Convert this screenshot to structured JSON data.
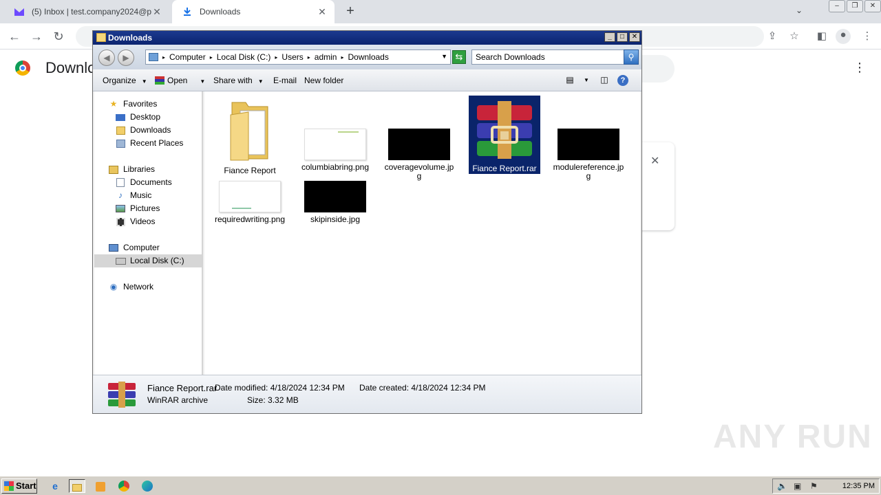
{
  "browser": {
    "tabs": [
      {
        "title": "(5) Inbox | test.company2024@prot",
        "icon": "proton-mail-icon",
        "active": false
      },
      {
        "title": "Downloads",
        "icon": "download-icon",
        "active": true
      }
    ],
    "page_title": "Downlo"
  },
  "explorer": {
    "title": "Downloads",
    "breadcrumb": [
      "Computer",
      "Local Disk (C:)",
      "Users",
      "admin",
      "Downloads"
    ],
    "search_placeholder": "Search Downloads",
    "commands": {
      "organize": "Organize",
      "open": "Open",
      "share_with": "Share with",
      "email": "E-mail",
      "new_folder": "New folder"
    },
    "nav": {
      "favorites": "Favorites",
      "desktop": "Desktop",
      "downloads": "Downloads",
      "recent_places": "Recent Places",
      "libraries": "Libraries",
      "documents": "Documents",
      "music": "Music",
      "pictures": "Pictures",
      "videos": "Videos",
      "computer": "Computer",
      "local_disk": "Local Disk (C:)",
      "network": "Network"
    },
    "files": [
      {
        "name": "Fiance Report",
        "type": "folder"
      },
      {
        "name": "columbiabring.png",
        "type": "image-light"
      },
      {
        "name": "coveragevolume.jpg",
        "type": "image-dark"
      },
      {
        "name": "Fiance Report.rar",
        "type": "rar",
        "selected": true
      },
      {
        "name": "modulereference.jpg",
        "type": "image-dark"
      },
      {
        "name": "requiredwriting.png",
        "type": "image-light"
      },
      {
        "name": "skipinside.jpg",
        "type": "image-dark"
      }
    ],
    "details": {
      "name": "Fiance Report.rar",
      "type": "WinRAR archive",
      "modified_label": "Date modified:",
      "modified": "4/18/2024 12:34 PM",
      "created_label": "Date created:",
      "created": "4/18/2024 12:34 PM",
      "size_label": "Size:",
      "size": "3.32 MB"
    }
  },
  "taskbar": {
    "start": "Start",
    "clock": "12:35 PM"
  },
  "watermark": "ANY RUN"
}
